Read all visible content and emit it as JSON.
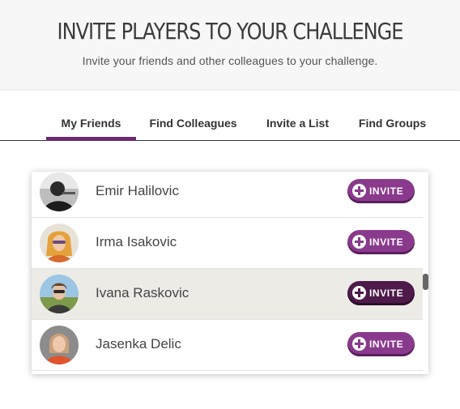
{
  "header": {
    "title": "INVITE PLAYERS TO YOUR CHALLENGE",
    "subtitle": "Invite your friends and other colleagues to your challenge."
  },
  "tabs": [
    {
      "label": "My Friends",
      "active": true
    },
    {
      "label": "Find Colleagues",
      "active": false
    },
    {
      "label": "Invite a List",
      "active": false
    },
    {
      "label": "Find Groups",
      "active": false
    }
  ],
  "friends": [
    {
      "name": "Emir Halilovic",
      "avatar": "avatar-photo",
      "button": "INVITE",
      "highlighted": false
    },
    {
      "name": "Irma Isakovic",
      "avatar": "avatar-photo",
      "button": "INVITE",
      "highlighted": false
    },
    {
      "name": "Ivana Raskovic",
      "avatar": "avatar-photo",
      "button": "INVITE",
      "highlighted": true
    },
    {
      "name": "Jasenka Delic",
      "avatar": "avatar-photo",
      "button": "INVITE",
      "highlighted": false
    }
  ],
  "colors": {
    "accent": "#6c2a6e",
    "button": "#8a3a8d",
    "button_active": "#4d1a4a",
    "row_highlight": "#ecebe6"
  },
  "icons": {
    "invite": "plus-circle-icon"
  }
}
